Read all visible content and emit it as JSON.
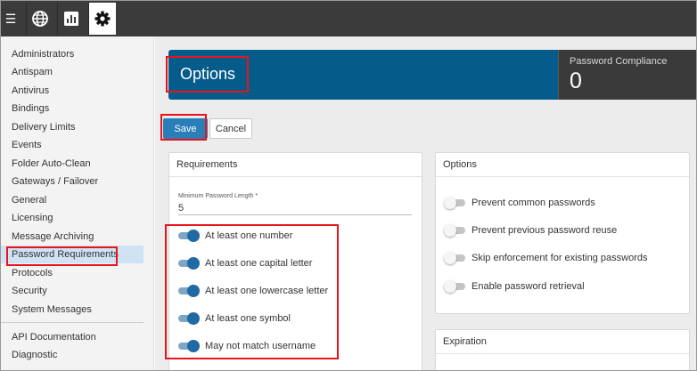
{
  "toolbar": {
    "menu_icon": "hamburger-icon",
    "buttons": [
      {
        "icon": "globe-icon",
        "active": false
      },
      {
        "icon": "bar-chart-icon",
        "active": false
      },
      {
        "icon": "gear-icon",
        "active": true
      }
    ]
  },
  "sidebar": {
    "items": [
      {
        "label": "Administrators"
      },
      {
        "label": "Antispam"
      },
      {
        "label": "Antivirus"
      },
      {
        "label": "Bindings"
      },
      {
        "label": "Delivery Limits"
      },
      {
        "label": "Events"
      },
      {
        "label": "Folder Auto-Clean"
      },
      {
        "label": "Gateways / Failover"
      },
      {
        "label": "General"
      },
      {
        "label": "Licensing"
      },
      {
        "label": "Message Archiving"
      },
      {
        "label": "Password Requirements",
        "selected": true
      },
      {
        "label": "Protocols"
      },
      {
        "label": "Security"
      },
      {
        "label": "System Messages"
      }
    ],
    "secondary_items": [
      {
        "label": "API Documentation"
      },
      {
        "label": "Diagnostic"
      }
    ]
  },
  "header": {
    "title": "Options",
    "stat_label": "Password Compliance",
    "stat_value": "0"
  },
  "actions": {
    "save_label": "Save",
    "cancel_label": "Cancel"
  },
  "requirements": {
    "title": "Requirements",
    "min_length_label": "Minimum Password Length *",
    "min_length_value": "5",
    "toggles": [
      {
        "label": "At least one number",
        "on": true
      },
      {
        "label": "At least one capital letter",
        "on": true
      },
      {
        "label": "At least one lowercase letter",
        "on": true
      },
      {
        "label": "At least one symbol",
        "on": true
      },
      {
        "label": "May not match username",
        "on": true
      }
    ]
  },
  "options": {
    "title": "Options",
    "toggles": [
      {
        "label": "Prevent common passwords",
        "on": false
      },
      {
        "label": "Prevent previous password reuse",
        "on": false
      },
      {
        "label": "Skip enforcement for existing passwords",
        "on": false
      },
      {
        "label": "Enable password retrieval",
        "on": false
      }
    ]
  },
  "expiration": {
    "title": "Expiration"
  },
  "colors": {
    "banner": "#055c8b",
    "accent": "#2a7fb8",
    "toggle_on": "#1f6aa5",
    "highlight": "#e8141c"
  }
}
